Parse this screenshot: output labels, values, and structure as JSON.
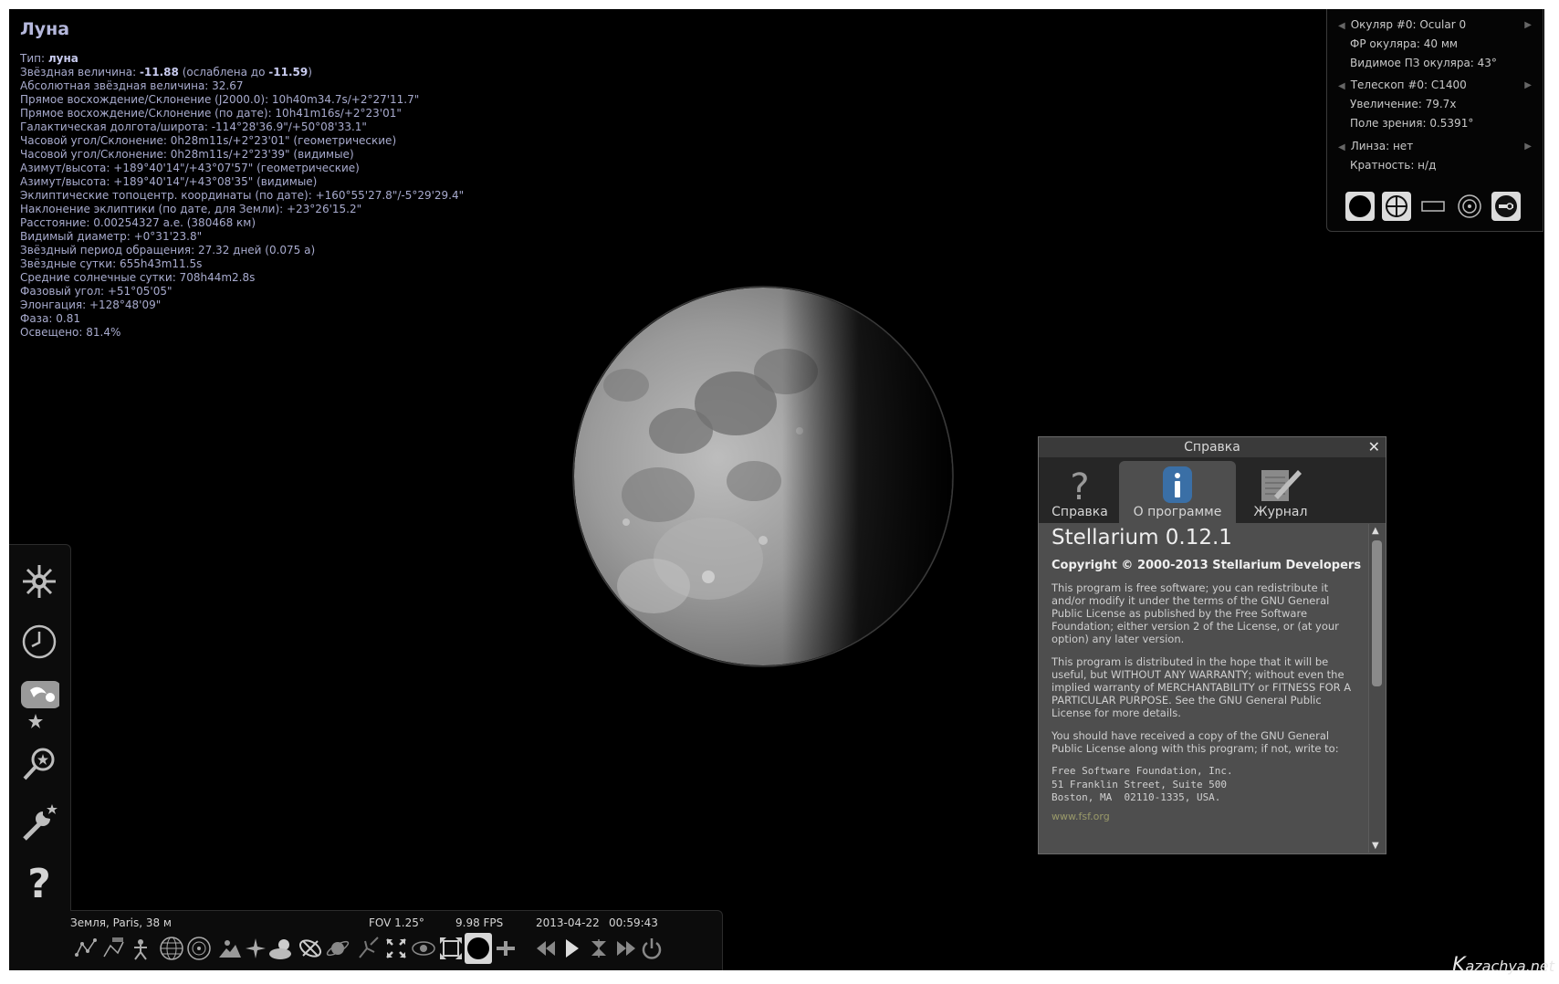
{
  "object": {
    "name": "Луна",
    "lines": [
      {
        "label": "Тип: ",
        "value": "луна"
      },
      {
        "label": "Звёздная величина: ",
        "value": "-11.88",
        "rest1": " (ослаблена до ",
        "value2": "-11.59",
        "rest2": ")"
      },
      {
        "text": "Абсолютная звёздная величина: 32.67"
      },
      {
        "text": "Прямое восхождение/Склонение (J2000.0): 10h40m34.7s/+2°27'11.7\""
      },
      {
        "text": "Прямое восхождение/Склонение (по дате): 10h41m16s/+2°23'01\""
      },
      {
        "text": "Галактическая долгота/широта: -114°28'36.9\"/+50°08'33.1\""
      },
      {
        "text": "Часовой угол/Склонение: 0h28m11s/+2°23'01\" (геометрические)"
      },
      {
        "text": "Часовой угол/Склонение: 0h28m11s/+2°23'39\" (видимые)"
      },
      {
        "text": "Азимут/высота: +189°40'14\"/+43°07'57\" (геометрические)"
      },
      {
        "text": "Азимут/высота: +189°40'14\"/+43°08'35\" (видимые)"
      },
      {
        "text": "Эклиптические топоцентр. координаты (по дате): +160°55'27.8\"/-5°29'29.4\""
      },
      {
        "text": "Наклонение эклиптики (по дате, для Земли): +23°26'15.2\""
      },
      {
        "text": "Расстояние: 0.00254327 а.е. (380468 км)"
      },
      {
        "text": "Видимый диаметр: +0°31'23.8\""
      },
      {
        "text": "Звёздный период обращения: 27.32 дней (0.075 a)"
      },
      {
        "text": "Звёздные сутки: 655h43m11.5s"
      },
      {
        "text": "Средние солнечные сутки: 708h44m2.8s"
      },
      {
        "text": "Фазовый угол: +51°05'05\""
      },
      {
        "text": "Элонгация: +128°48'09\""
      },
      {
        "text": "Фаза: 0.81"
      },
      {
        "text": "Освещено: 81.4%"
      }
    ]
  },
  "ocular": {
    "eyepiece": "Окуляр #0: Ocular 0",
    "eyepiece_fl": "ФР окуляра: 40 мм",
    "eyepiece_fov": "Видимое ПЗ окуляра: 43°",
    "telescope": "Телескоп #0: C1400",
    "magnification": "Увеличение: 79.7x",
    "fov": "Поле зрения: 0.5391°",
    "lens": "Линза: нет",
    "lens_mult": "Кратность: н/д",
    "buttons": [
      "ocular-view-icon",
      "crosshair-icon",
      "ccd-frame-icon",
      "telrad-icon",
      "configure-icon"
    ]
  },
  "help_dialog": {
    "title": "Справка",
    "close": "✕",
    "tabs": [
      {
        "label": "Справка",
        "icon": "question-icon"
      },
      {
        "label": "О программе",
        "icon": "info-icon",
        "active": true
      },
      {
        "label": "Журнал",
        "icon": "notepad-pen-icon"
      }
    ],
    "heading": "Stellarium 0.12.1",
    "copyright": "Copyright © 2000-2013 Stellarium Developers",
    "paragraphs": [
      "This program is free software; you can redistribute it and/or modify it under the terms of the GNU General Public License as published by the Free Software Foundation; either version 2 of the License, or (at your option) any later version.",
      "This program is distributed in the hope that it will be useful, but WITHOUT ANY WARRANTY; without even the implied warranty of MERCHANTABILITY or FITNESS FOR A PARTICULAR PURPOSE. See the GNU General Public License for more details.",
      "You should have received a copy of the GNU General Public License along with this program; if not, write to:"
    ],
    "address": "Free Software Foundation, Inc.\n51 Franklin Street, Suite 500\nBoston, MA  02110-1335, USA.",
    "link": "www.fsf.org"
  },
  "left_toolbar": [
    "sky-settings-icon",
    "clock-icon",
    "sky-view-icon",
    "search-icon",
    "configuration-icon",
    "help-icon"
  ],
  "status": {
    "location": "Земля, Paris, 38 м",
    "fov": "FOV 1.25°",
    "fps": "9.98 FPS",
    "date": "2013-04-22",
    "time": "00:59:43"
  },
  "bottom_icons": [
    "constellation-lines-icon",
    "constellation-labels-icon",
    "constellation-art-icon",
    "equatorial-grid-icon",
    "azimuthal-grid-icon",
    "ground-icon",
    "cardinal-points-icon",
    "atmosphere-icon",
    "nebulae-icon",
    "planet-labels-icon",
    "satellites-icon",
    "mount-mode-icon",
    "night-mode-icon",
    "fullscreen-icon",
    "ocular-icon",
    "telescope-control-icon",
    "rewind-icon",
    "play-icon",
    "now-icon",
    "fast-forward-icon",
    "quit-icon"
  ],
  "watermark": {
    "big": "K",
    "rest": "azachya.net"
  }
}
